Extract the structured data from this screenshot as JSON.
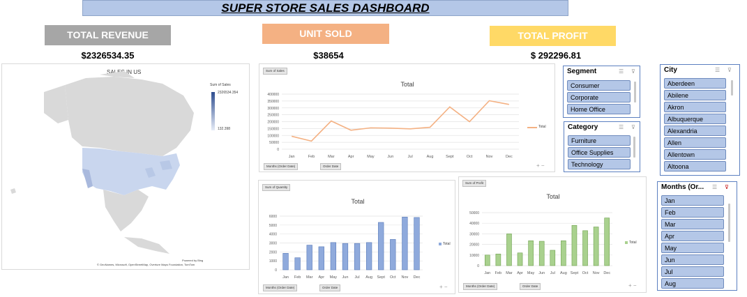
{
  "title": "SUPER STORE SALES DASHBOARD",
  "kpis": {
    "revenue": {
      "label": "TOTAL REVENUE",
      "value": "$2326534.35",
      "color": "#a6a6a6"
    },
    "units": {
      "label": "UNIT SOLD",
      "value": "$38654",
      "color": "#f4b183"
    },
    "profit": {
      "label": "TOTAL PROFIT",
      "value": "$ 292296.81",
      "color": "#ffd966"
    }
  },
  "map": {
    "title": "SALES IN US",
    "legend_title": "Sum of Sales",
    "legend_max": "2326534.354",
    "legend_min": "132.398",
    "powered": "Powered by Bing",
    "credits": "© GeoNames, Microsoft, OpenStreetMap, Overture Maps Foundation, TomTom"
  },
  "charts": {
    "sales": {
      "field": "Sum of Sales",
      "legend": "Total",
      "btn1": "Months (Order Date)",
      "btn2": "Order Date"
    },
    "quantity": {
      "field": "Sum of Quantity",
      "legend": "Total",
      "btn1": "Months (Order Date)",
      "btn2": "Order Date"
    },
    "profit": {
      "field": "Sum of Profit",
      "legend": "Total",
      "btn1": "Months (Order Date)",
      "btn2": "Order Date"
    }
  },
  "chart_data": [
    {
      "type": "line",
      "title": "Total",
      "categories": [
        "Jan",
        "Feb",
        "Mar",
        "Apr",
        "May",
        "Jun",
        "Jul",
        "Aug",
        "Sept",
        "Oct",
        "Nov",
        "Dec"
      ],
      "series": [
        {
          "name": "Total",
          "values": [
            94000,
            59000,
            205000,
            138000,
            155000,
            153000,
            148000,
            159000,
            307000,
            200000,
            352000,
            325000
          ]
        }
      ],
      "ylim": [
        0,
        400000
      ],
      "yticks": [
        "0",
        "50000",
        "100000",
        "150000",
        "200000",
        "250000",
        "300000",
        "350000",
        "400000"
      ],
      "color": "#f4b183"
    },
    {
      "type": "bar",
      "title": "Total",
      "categories": [
        "Jan",
        "Feb",
        "Mar",
        "Apr",
        "May",
        "Jun",
        "Jul",
        "Aug",
        "Sept",
        "Oct",
        "Nov",
        "Dec"
      ],
      "series": [
        {
          "name": "Total",
          "values": [
            1845,
            1350,
            2760,
            2580,
            3050,
            2950,
            2950,
            3050,
            5300,
            3400,
            5900,
            5850
          ]
        }
      ],
      "ylim": [
        0,
        6000
      ],
      "yticks": [
        "0",
        "1000",
        "2000",
        "3000",
        "4000",
        "5000",
        "6000"
      ],
      "color": "#8faadc"
    },
    {
      "type": "bar",
      "title": "Total",
      "categories": [
        "Jan",
        "Feb",
        "Mar",
        "Apr",
        "May",
        "Jun",
        "Jul",
        "Aug",
        "Sept",
        "Oct",
        "Nov",
        "Dec"
      ],
      "series": [
        {
          "name": "Total",
          "values": [
            10000,
            11000,
            30000,
            12000,
            23500,
            23000,
            14500,
            23500,
            38000,
            33000,
            36500,
            45000
          ]
        }
      ],
      "ylim": [
        0,
        50000
      ],
      "yticks": [
        "0",
        "10000",
        "20000",
        "30000",
        "40000",
        "50000"
      ],
      "color": "#a9d18e"
    }
  ],
  "slicers": {
    "segment": {
      "title": "Segment",
      "items": [
        "Consumer",
        "Corporate",
        "Home Office"
      ]
    },
    "category": {
      "title": "Category",
      "items": [
        "Furniture",
        "Office Supplies",
        "Technology"
      ]
    },
    "city": {
      "title": "City",
      "items": [
        "Aberdeen",
        "Abilene",
        "Akron",
        "Albuquerque",
        "Alexandria",
        "Allen",
        "Allentown",
        "Altoona"
      ]
    },
    "months": {
      "title": "Months (Or...",
      "items": [
        "Jan",
        "Feb",
        "Mar",
        "Apr",
        "May",
        "Jun",
        "Jul",
        "Aug"
      ]
    }
  }
}
